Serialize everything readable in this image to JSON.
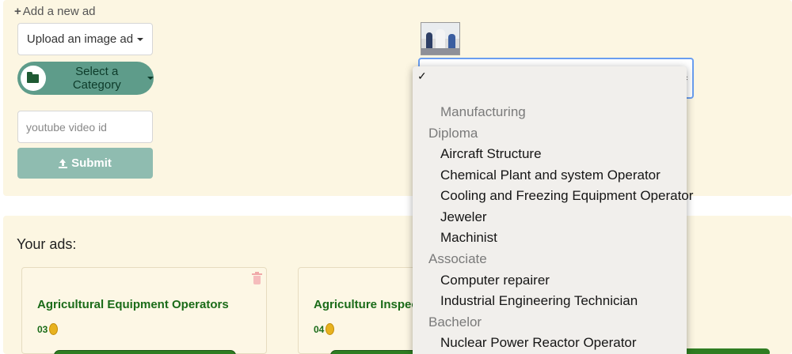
{
  "form": {
    "add_title": "Add a new ad",
    "upload_label": "Upload an image ad",
    "category_label": "Select a Category",
    "youtube_placeholder": "youtube video id",
    "youtube_value": "",
    "submit_label": "Submit"
  },
  "dropdown": {
    "selected_marker": "✓",
    "items": [
      {
        "text": "Manufacturing",
        "kind": "option-dim"
      },
      {
        "text": "Diploma",
        "kind": "group"
      },
      {
        "text": "Aircraft Structure",
        "kind": "option"
      },
      {
        "text": "Chemical Plant and system Operator",
        "kind": "option"
      },
      {
        "text": "Cooling and Freezing Equipment Operator",
        "kind": "option"
      },
      {
        "text": "Jeweler",
        "kind": "option"
      },
      {
        "text": "Machinist",
        "kind": "option"
      },
      {
        "text": "Associate",
        "kind": "group"
      },
      {
        "text": "Computer repairer",
        "kind": "option"
      },
      {
        "text": "Industrial Engineering Technician",
        "kind": "option"
      },
      {
        "text": "Bachelor",
        "kind": "group"
      },
      {
        "text": "Nuclear Power Reactor Operator",
        "kind": "option"
      }
    ]
  },
  "ads": {
    "heading": "Your ads:",
    "cards": [
      {
        "title": "Agricultural Equipment Operators",
        "count": "03"
      },
      {
        "title": "Agriculture Inspector",
        "count": "04"
      }
    ]
  },
  "colors": {
    "panel_bg": "#fcf6e2",
    "category_button": "#5e9c8a",
    "submit_button": "#8fbcb0",
    "ad_title_green": "#1a6b18",
    "select_focus": "#6a9ef0"
  },
  "icons": [
    "plus-icon",
    "caret-down-icon",
    "folder-open-icon",
    "upload-icon",
    "select-arrows-icon",
    "coin-icon",
    "trash-icon"
  ]
}
